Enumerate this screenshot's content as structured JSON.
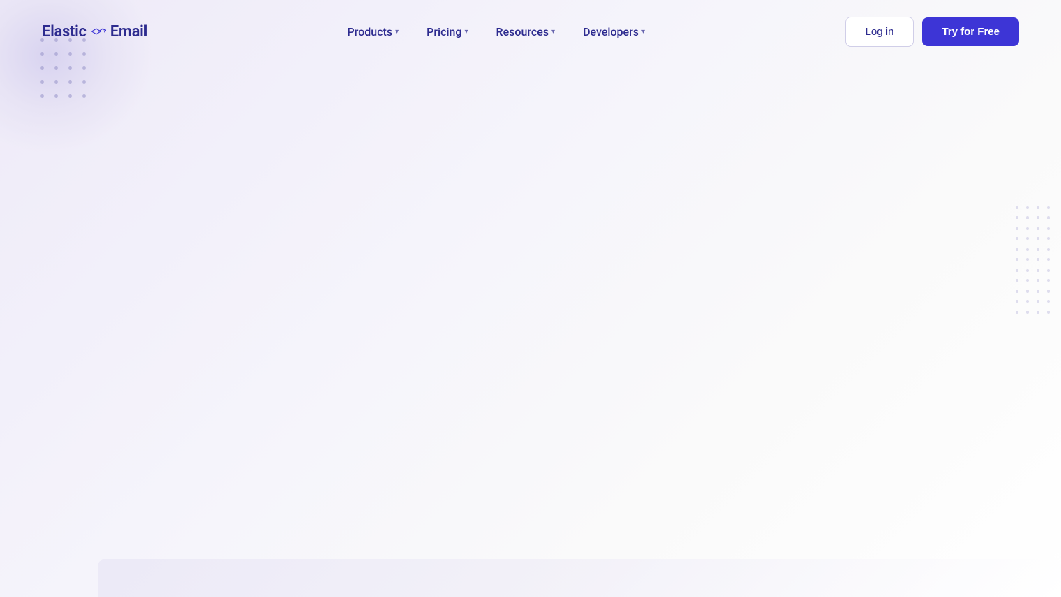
{
  "brand": {
    "name_part1": "Elastic",
    "name_part2": "Email",
    "logo_icon_alt": "email-arrows-icon"
  },
  "navbar": {
    "items": [
      {
        "label": "Products",
        "has_dropdown": true
      },
      {
        "label": "Pricing",
        "has_dropdown": true
      },
      {
        "label": "Resources",
        "has_dropdown": true
      },
      {
        "label": "Developers",
        "has_dropdown": true
      }
    ],
    "chevron": "▾"
  },
  "cta": {
    "login_label": "Log in",
    "try_label": "Try for Free"
  },
  "dots": {
    "topleft_count": 20,
    "right_count": 44
  }
}
